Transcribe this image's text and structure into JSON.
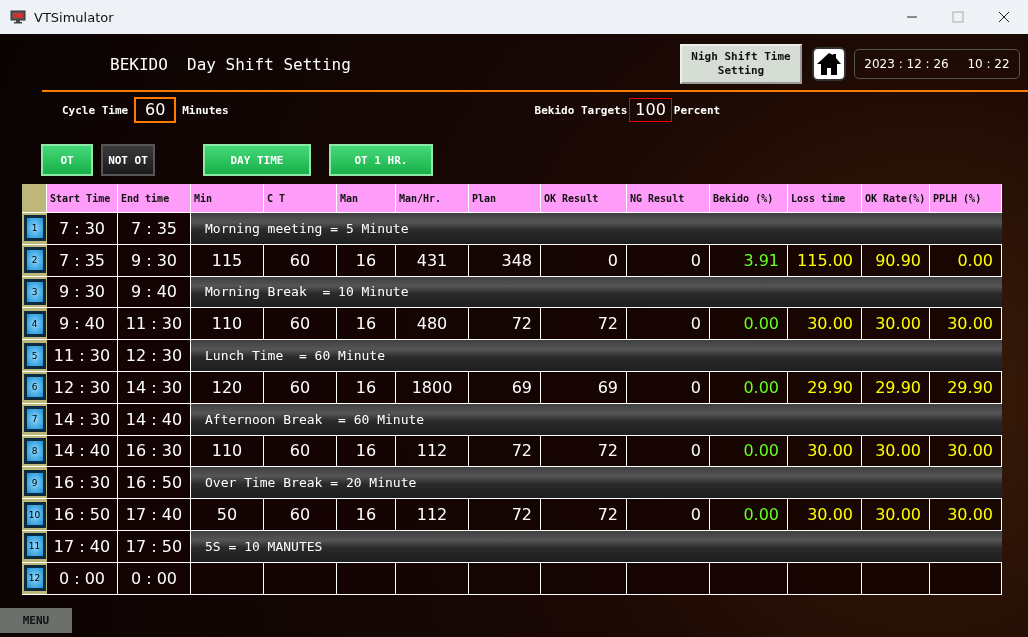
{
  "window": {
    "title": "VTSimulator"
  },
  "header": {
    "title": "BEKIDO  Day Shift Setting",
    "night_button": "Nigh Shift Time Setting",
    "clock": {
      "date": "2023 : 12 : 26",
      "time": "10 : 22"
    }
  },
  "settings": {
    "cycle_time": {
      "label": "Cycle Time",
      "value": "60",
      "unit": "Minutes"
    },
    "bekido_target": {
      "label": "Bekido Targets",
      "value": "100",
      "unit": "Percent"
    }
  },
  "mode_buttons": [
    {
      "label": "OT",
      "active": true
    },
    {
      "label": "NOT OT",
      "active": false
    },
    {
      "label": "DAY TIME",
      "active": true
    },
    {
      "label": "OT 1 HR.",
      "active": true
    }
  ],
  "table": {
    "columns": [
      "Start Time",
      "End time",
      "Min",
      "C T",
      "Man",
      "Man/Hr.",
      "Plan",
      "OK Result",
      "NG Result",
      "Bekido (%)",
      "Loss time",
      "OK Rate(%)",
      "PPLH (%)"
    ],
    "rows": [
      {
        "no": "1",
        "kind": "break",
        "start": "7 : 30",
        "end": "7 : 35",
        "note": "Morning meeting = 5 Minute"
      },
      {
        "no": "2",
        "kind": "data",
        "start": "7 : 35",
        "end": "9 : 30",
        "values": [
          "115",
          "60",
          "16",
          "431",
          "348",
          "0",
          "0",
          "3.91",
          "115.00",
          "90.90",
          "0.00"
        ]
      },
      {
        "no": "3",
        "kind": "break",
        "start": "9 : 30",
        "end": "9 : 40",
        "note": "Morning Break  = 10 Minute"
      },
      {
        "no": "4",
        "kind": "data",
        "start": "9 : 40",
        "end": "11 : 30",
        "values": [
          "110",
          "60",
          "16",
          "480",
          "72",
          "72",
          "0",
          "0.00",
          "30.00",
          "30.00",
          "30.00"
        ]
      },
      {
        "no": "5",
        "kind": "break",
        "start": "11 : 30",
        "end": "12 : 30",
        "note": "Lunch Time  = 60 Minute"
      },
      {
        "no": "6",
        "kind": "data",
        "start": "12 : 30",
        "end": "14 : 30",
        "values": [
          "120",
          "60",
          "16",
          "1800",
          "69",
          "69",
          "0",
          "0.00",
          "29.90",
          "29.90",
          "29.90"
        ]
      },
      {
        "no": "7",
        "kind": "break",
        "start": "14 : 30",
        "end": "14 : 40",
        "note": "Afternoon Break  = 60 Minute"
      },
      {
        "no": "8",
        "kind": "data",
        "start": "14 : 40",
        "end": "16 : 30",
        "values": [
          "110",
          "60",
          "16",
          "112",
          "72",
          "72",
          "0",
          "0.00",
          "30.00",
          "30.00",
          "30.00"
        ]
      },
      {
        "no": "9",
        "kind": "break",
        "start": "16 : 30",
        "end": "16 : 50",
        "note": "Over Time Break = 20 Minute"
      },
      {
        "no": "10",
        "kind": "data",
        "start": "16 : 50",
        "end": "17 : 40",
        "values": [
          "50",
          "60",
          "16",
          "112",
          "72",
          "72",
          "0",
          "0.00",
          "30.00",
          "30.00",
          "30.00"
        ]
      },
      {
        "no": "11",
        "kind": "break",
        "start": "17 : 40",
        "end": "17 : 50",
        "note": "5S = 10 MANUTES"
      },
      {
        "no": "12",
        "kind": "empty",
        "start": "0 : 00",
        "end": "0 : 00"
      }
    ]
  },
  "menu": {
    "label": "MENU"
  }
}
